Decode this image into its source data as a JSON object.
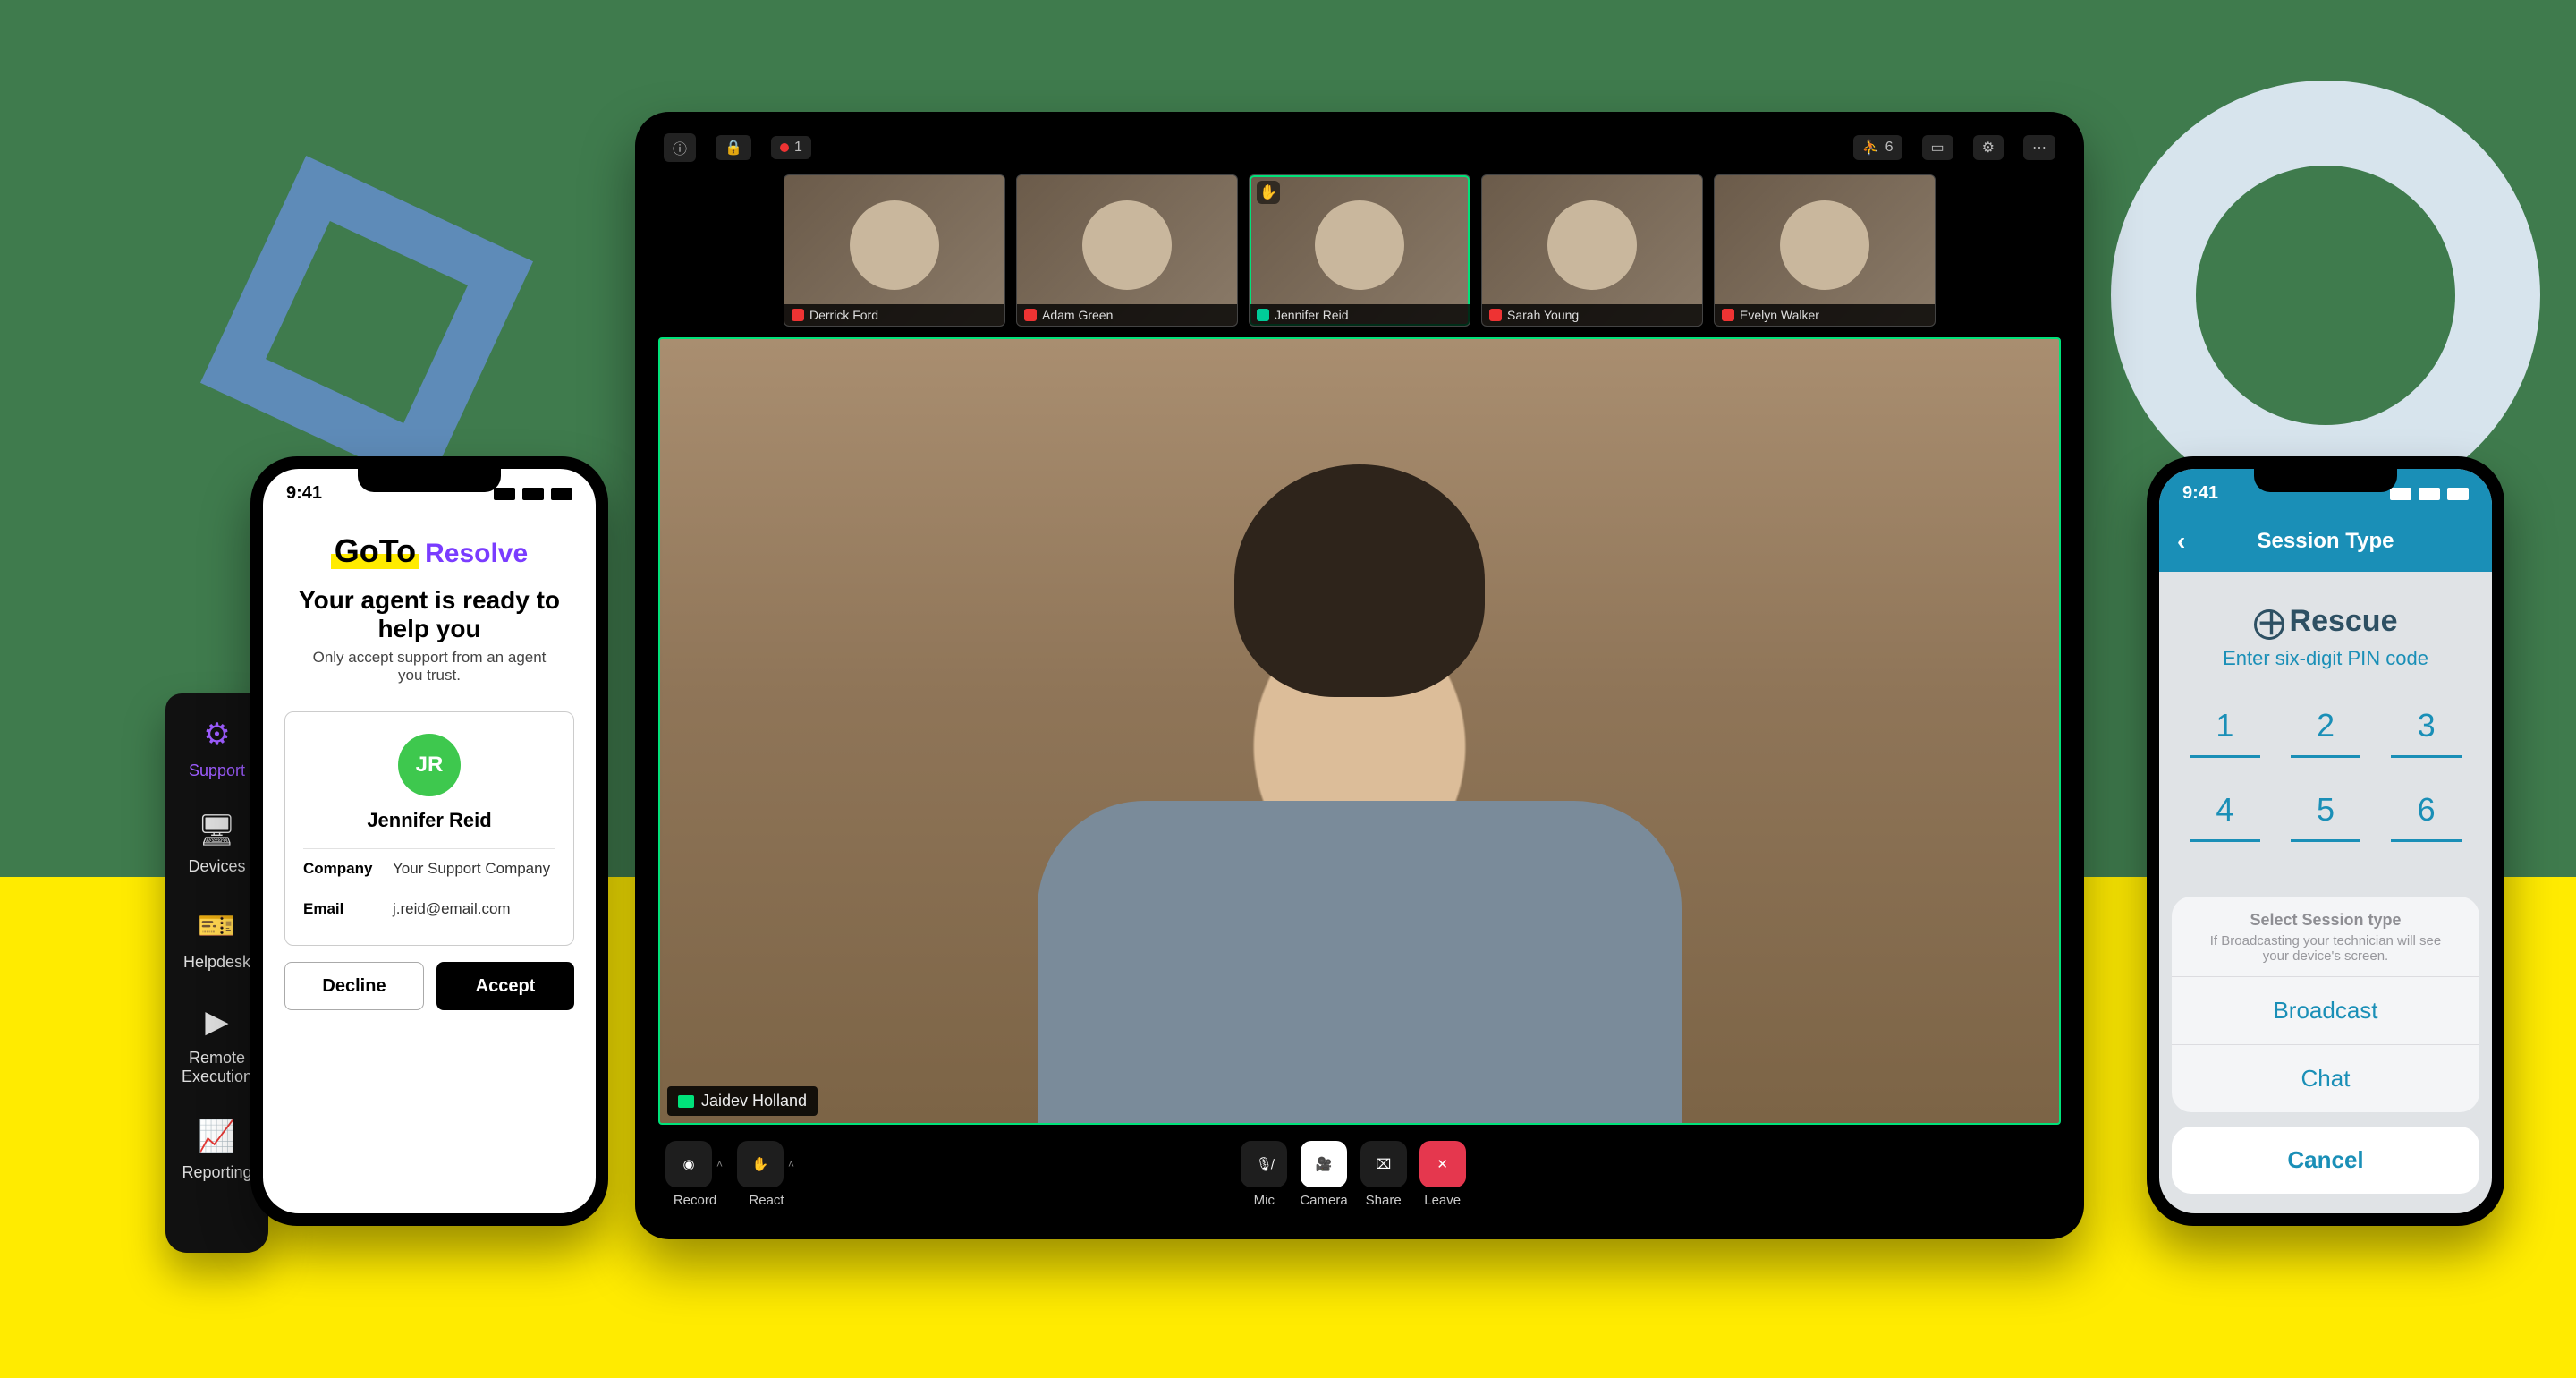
{
  "statusbar_time": "9:41",
  "meeting": {
    "participant_count": "6",
    "topbar_alert_count": "1",
    "thumbs": [
      {
        "name": "Derrick Ford",
        "muted": true
      },
      {
        "name": "Adam Green",
        "muted": true
      },
      {
        "name": "Jennifer Reid",
        "muted": false,
        "hand_raised": true
      },
      {
        "name": "Sarah Young",
        "muted": true
      },
      {
        "name": "Evelyn Walker",
        "muted": true
      }
    ],
    "main_speaker": "Jaidev Holland",
    "controls": {
      "record": "Record",
      "react": "React",
      "mic": "Mic",
      "camera": "Camera",
      "share": "Share",
      "leave": "Leave"
    }
  },
  "sidebar": {
    "items": [
      {
        "label": "Support"
      },
      {
        "label": "Devices"
      },
      {
        "label": "Helpdesk"
      },
      {
        "label": "Remote Execution"
      },
      {
        "label": "Reporting"
      }
    ]
  },
  "resolve": {
    "logo_brand": "GoTo",
    "logo_product": "Resolve",
    "headline": "Your agent is ready to help you",
    "subtext": "Only accept support from an agent you trust.",
    "agent_initials": "JR",
    "agent_name": "Jennifer Reid",
    "company_label": "Company",
    "company_value": "Your Support Company",
    "email_label": "Email",
    "email_value": "j.reid@email.com",
    "decline": "Decline",
    "accept": "Accept"
  },
  "rescue": {
    "header": "Session Type",
    "brand": "Rescue",
    "sub": "Enter six-digit PIN code",
    "pins": [
      "1",
      "2",
      "3",
      "4",
      "5",
      "6"
    ],
    "sheet_title": "Select Session type",
    "sheet_hint": "If Broadcasting your technician will see your device's screen.",
    "opt_broadcast": "Broadcast",
    "opt_chat": "Chat",
    "cancel": "Cancel"
  }
}
